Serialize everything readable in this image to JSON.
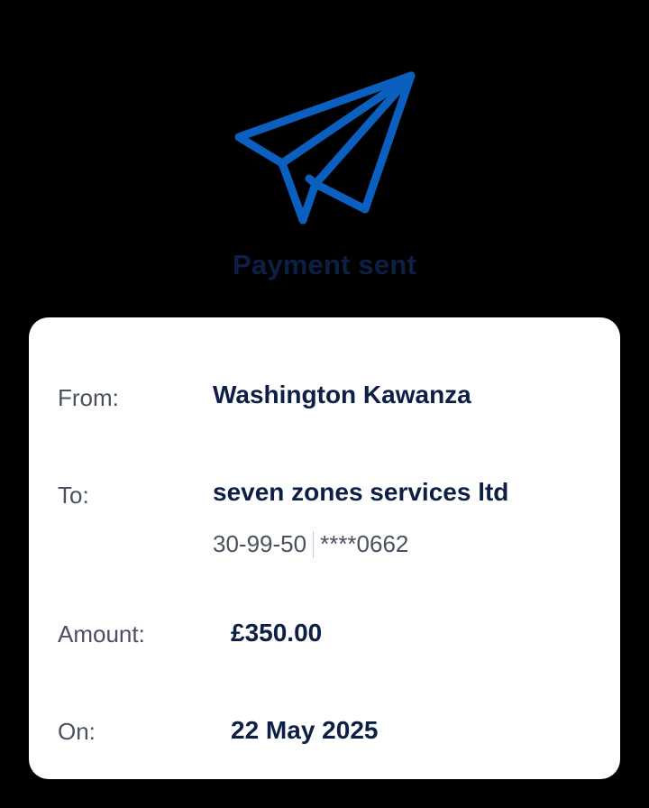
{
  "header": {
    "title": "Payment sent",
    "icon": "paper-plane-icon",
    "icon_color": "#0a5fbf",
    "title_color": "#0d1f45"
  },
  "details": {
    "from_label": "From:",
    "from_value": "Washington Kawanza",
    "to_label": "To:",
    "to_value": "seven zones services ltd",
    "sort_code": "30-99-50",
    "account_number": "****0662",
    "amount_label": "Amount:",
    "amount_value": "£350.00",
    "date_label": "On:",
    "date_value": "22 May 2025"
  }
}
